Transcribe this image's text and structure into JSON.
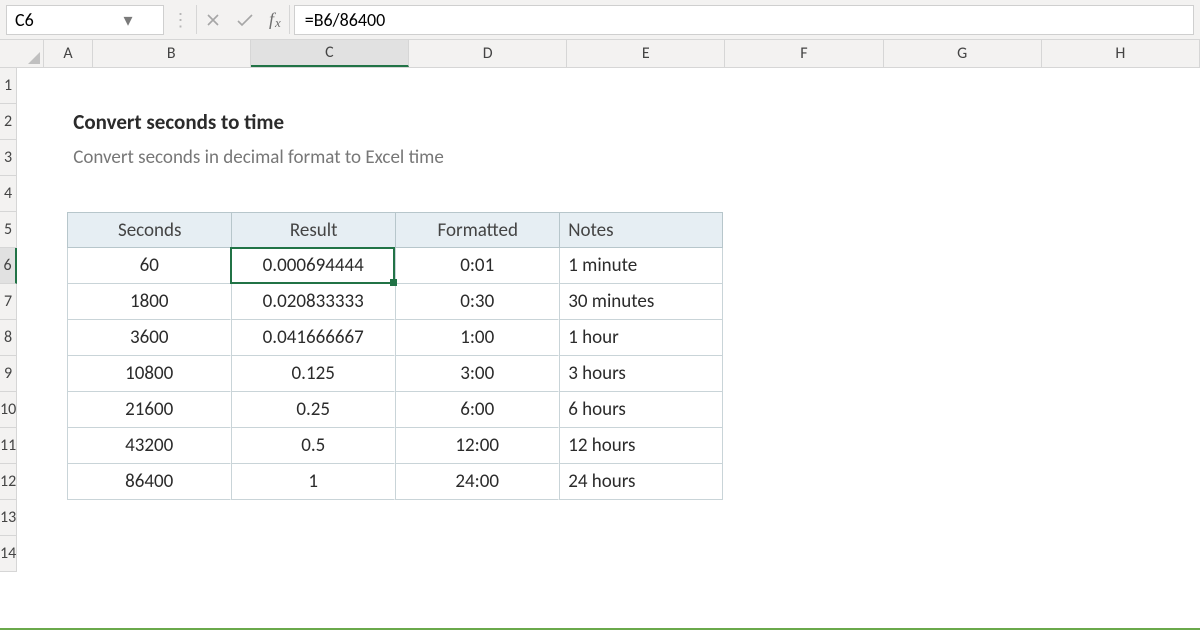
{
  "nameBox": {
    "value": "C6"
  },
  "formulaBar": {
    "value": "=B6/86400"
  },
  "columns": [
    "A",
    "B",
    "C",
    "D",
    "E",
    "F",
    "G",
    "H"
  ],
  "rows": [
    "1",
    "2",
    "3",
    "4",
    "5",
    "6",
    "7",
    "8",
    "9",
    "10",
    "11",
    "12",
    "13",
    "14"
  ],
  "activeCell": {
    "col": "C",
    "row": "6"
  },
  "content": {
    "title": "Convert seconds to time",
    "subtitle": "Convert seconds in decimal format to Excel time"
  },
  "table": {
    "headers": {
      "b": "Seconds",
      "c": "Result",
      "d": "Formatted",
      "e": "Notes"
    },
    "rows": [
      {
        "b": "60",
        "c": "0.000694444",
        "d": "0:01",
        "e": "1 minute"
      },
      {
        "b": "1800",
        "c": "0.020833333",
        "d": "0:30",
        "e": "30 minutes"
      },
      {
        "b": "3600",
        "c": "0.041666667",
        "d": "1:00",
        "e": "1 hour"
      },
      {
        "b": "10800",
        "c": "0.125",
        "d": "3:00",
        "e": "3 hours"
      },
      {
        "b": "21600",
        "c": "0.25",
        "d": "6:00",
        "e": "6 hours"
      },
      {
        "b": "43200",
        "c": "0.5",
        "d": "12:00",
        "e": "12 hours"
      },
      {
        "b": "86400",
        "c": "1",
        "d": "24:00",
        "e": "24 hours"
      }
    ]
  }
}
